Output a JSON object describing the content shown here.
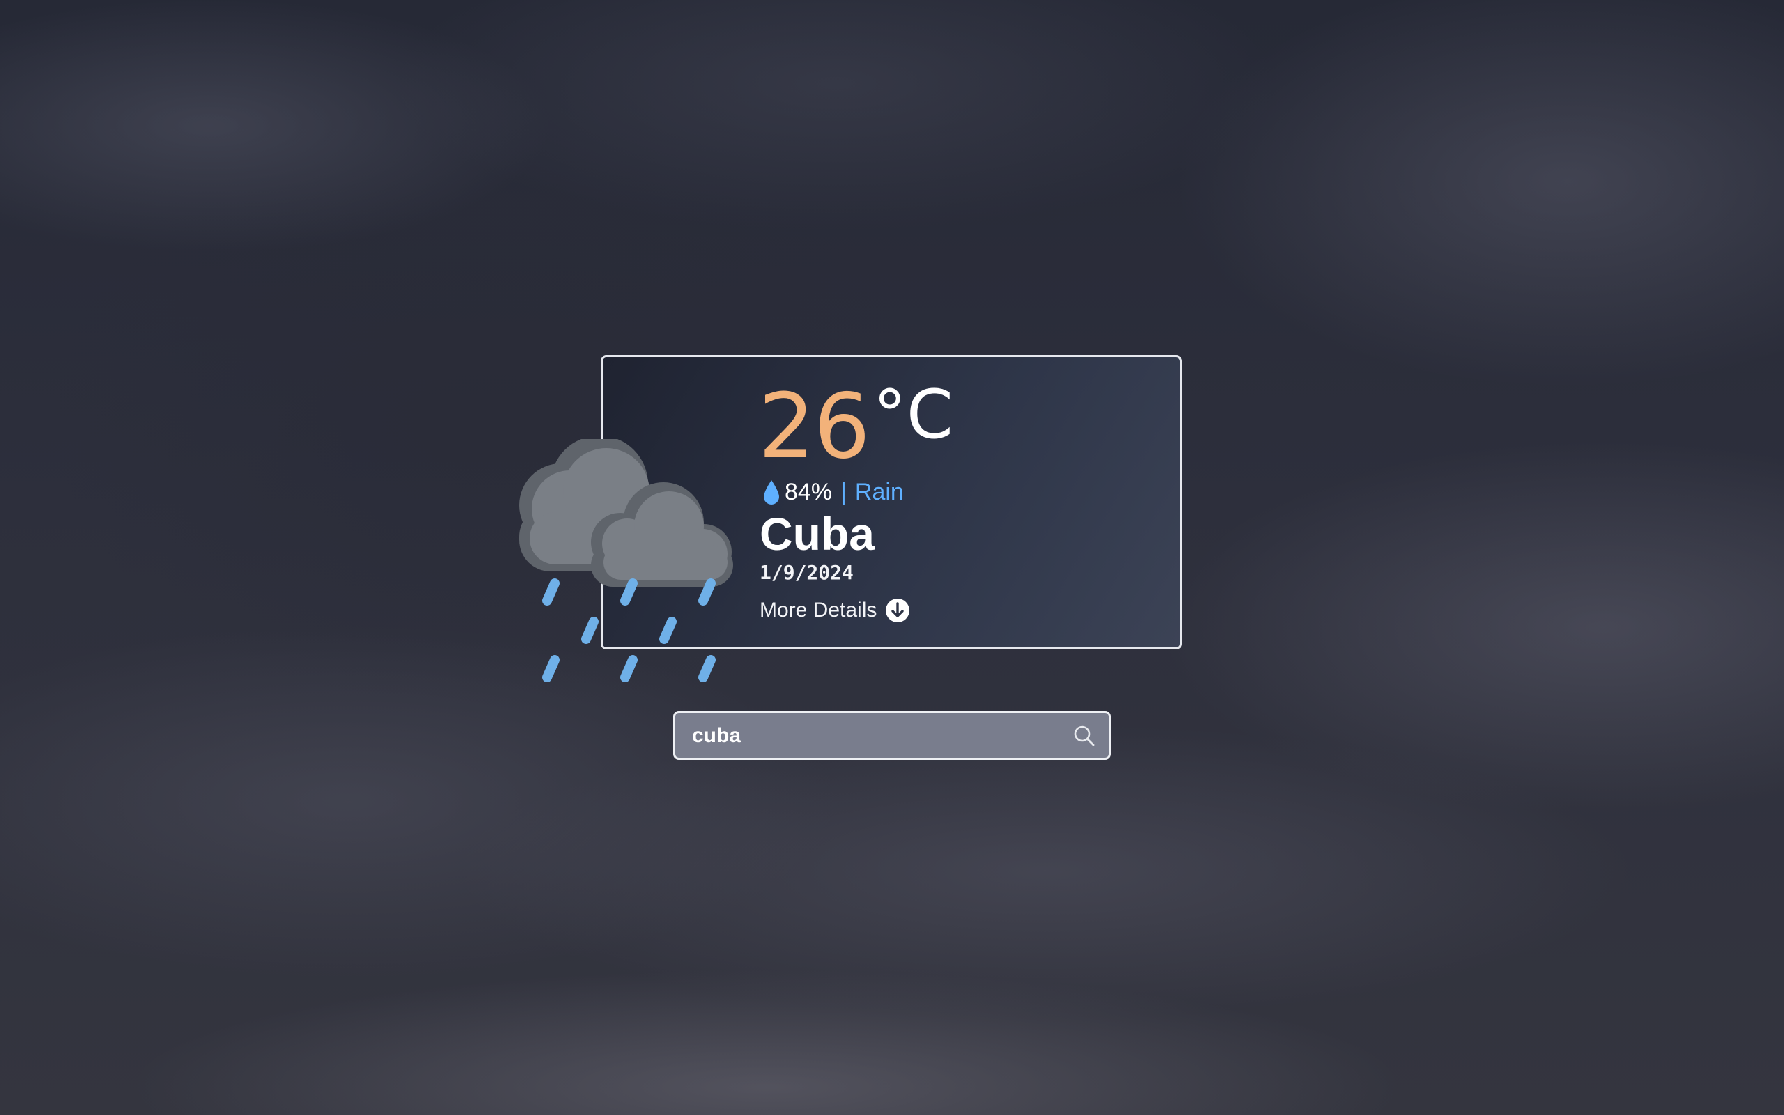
{
  "weather": {
    "temperature": "26",
    "unit": "°C",
    "humidity": "84%",
    "separator": "|",
    "condition": "Rain",
    "city": "Cuba",
    "date": "1/9/2024",
    "more_details_label": "More Details",
    "icon": "cloud-rain-icon"
  },
  "search": {
    "value": "cuba",
    "icon": "search-icon"
  },
  "colors": {
    "temperature": "#f2b27a",
    "condition": "#5fb0ff",
    "rain_drops": "#6fb0e8",
    "cloud": "#7a7f86"
  }
}
